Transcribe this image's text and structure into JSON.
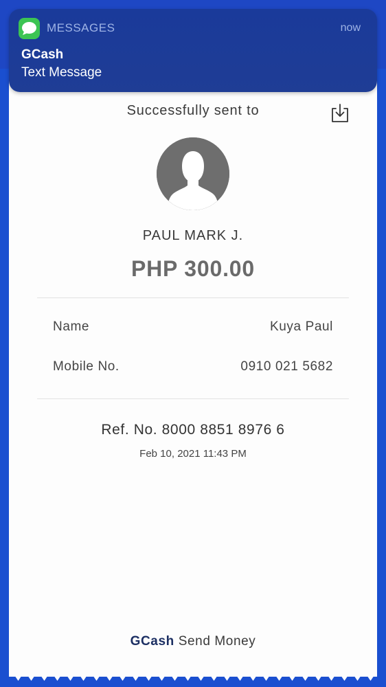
{
  "notification": {
    "app_name": "MESSAGES",
    "time": "now",
    "title": "GCash",
    "body": "Text Message",
    "icon": "messages-icon",
    "accent": "#3cc453"
  },
  "receipt": {
    "header": "Successfully sent to",
    "download_icon": "download-icon",
    "avatar_icon": "person-silhouette-icon",
    "recipient_name": "PAUL MARK J.",
    "amount": "PHP 300.00",
    "details": [
      {
        "label": "Name",
        "value": "Kuya Paul"
      },
      {
        "label": "Mobile No.",
        "value": "0910 021 5682"
      }
    ],
    "reference": "Ref. No. 8000 8851 8976 6",
    "datetime": "Feb 10, 2021 11:43 PM",
    "footer_brand": "GCash",
    "footer_text": " Send Money"
  },
  "colors": {
    "background_blue": "#1a4fd0",
    "notification_bg": "#1a3a9a",
    "brand_navy": "#1c2f63"
  }
}
